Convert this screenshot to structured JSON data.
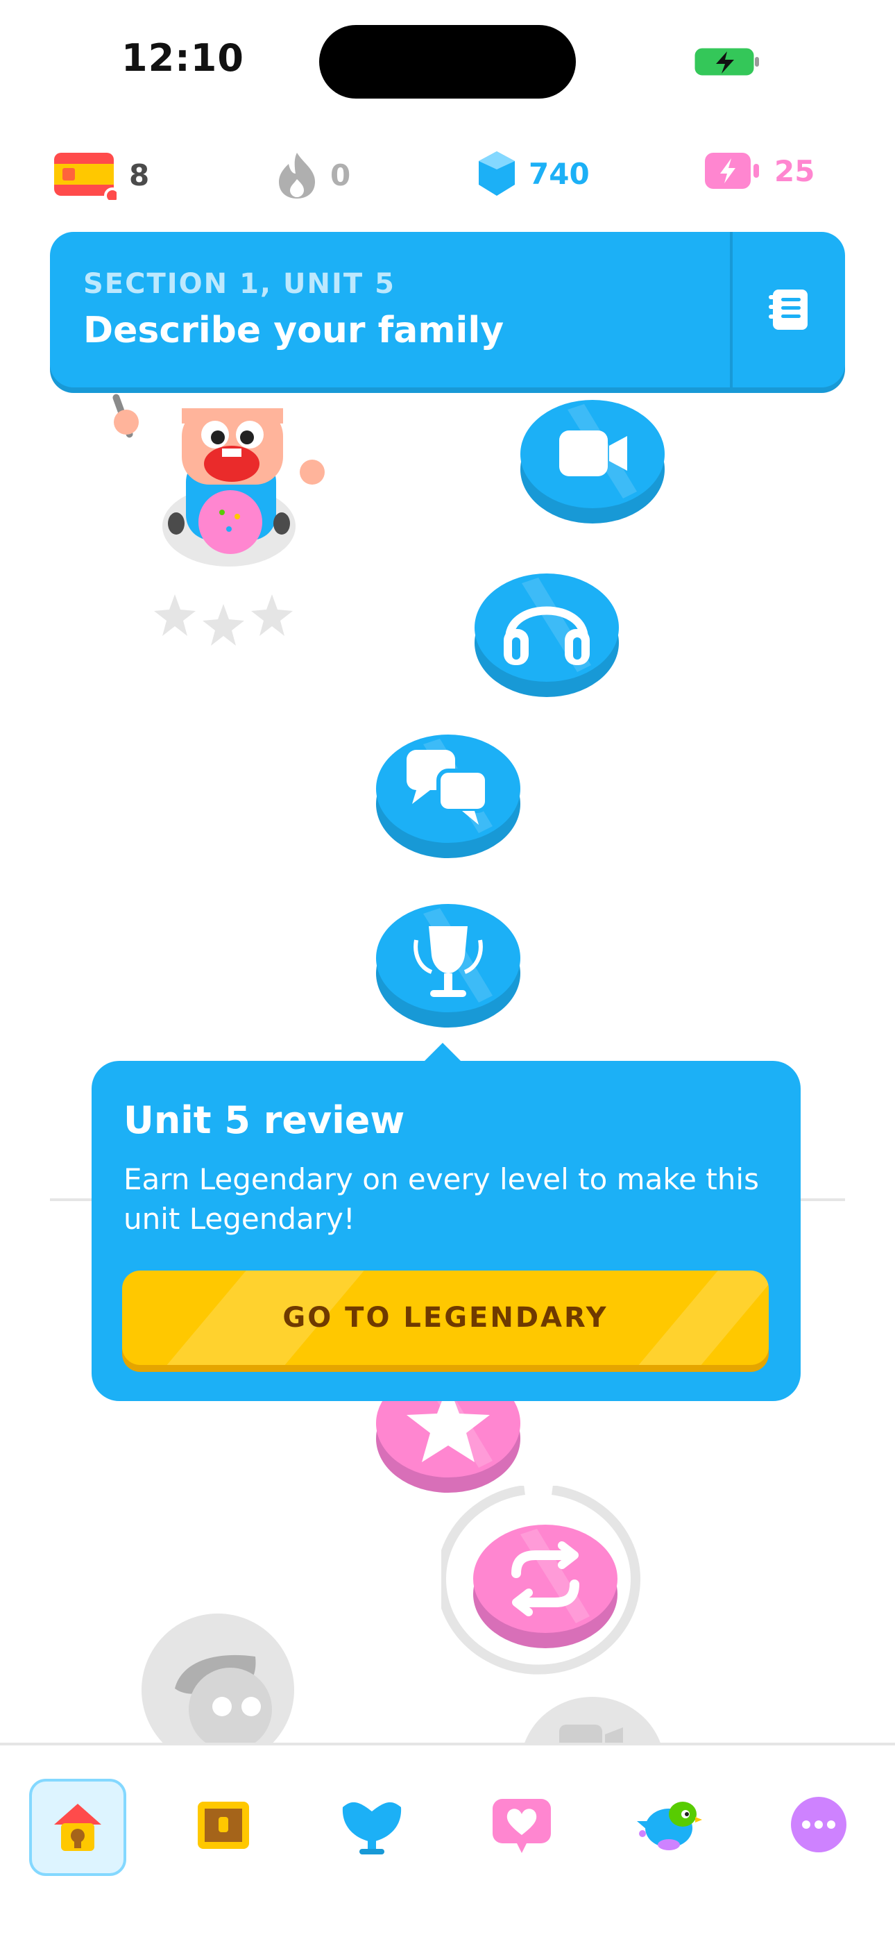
{
  "status_bar": {
    "time": "12:10"
  },
  "stats": {
    "flag": "Spanish",
    "streak_count": "8",
    "fire_count": "0",
    "gems": "740",
    "energy": "25"
  },
  "unit": {
    "section": "SECTION 1, UNIT 5",
    "title": "Describe your family"
  },
  "review": {
    "title": "Unit 5 review",
    "description": "Earn Legendary on every level to make this unit Legendary!",
    "button": "GO TO LEGENDARY"
  },
  "colors": {
    "accent_blue": "#1cb0f6",
    "accent_pink": "#ff86d0",
    "gold": "#ffc800",
    "gray": "#e5e5e5"
  },
  "icons": {
    "video": "video-icon",
    "headphones": "headphones-icon",
    "chat": "chat-icon",
    "trophy": "trophy-icon",
    "star": "star-icon",
    "repeat": "repeat-icon",
    "guidebook": "guidebook-icon"
  }
}
